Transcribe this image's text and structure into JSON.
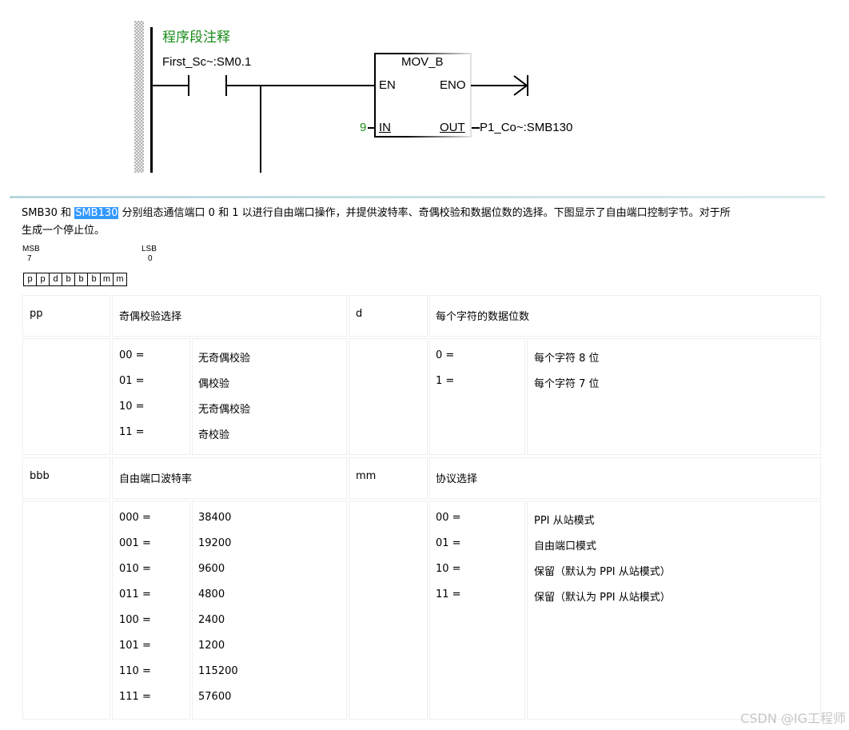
{
  "ladder": {
    "segment_comment": "程序段注释",
    "contact_label": "First_Sc~:SM0.1",
    "box_title": "MOV_B",
    "en": "EN",
    "eno": "ENO",
    "in_value": "9",
    "in_label": "IN",
    "out_label": "OUT",
    "out_address": "P1_Co~:SMB130"
  },
  "description": {
    "line1_pre": "SMB30 和 ",
    "line1_highlight": "SMB130",
    "line1_post": " 分别组态通信端口 0 和 1 以进行自由端口操作，并提供波特率、奇偶校验和数据位数的选择。下图显示了自由端口控制字节。对于所",
    "line2": "生成一个停止位。"
  },
  "bit_diagram": {
    "msb": "MSB",
    "msb_num": "7",
    "lsb": "LSB",
    "lsb_num": "0",
    "bits": [
      "p",
      "p",
      "d",
      "b",
      "b",
      "b",
      "m",
      "m"
    ]
  },
  "table1": {
    "h1": "pp",
    "h2": "奇偶校验选择",
    "h3": "d",
    "h4": "每个字符的数据位数",
    "parity": [
      {
        "code": "00 =",
        "desc": "无奇偶校验"
      },
      {
        "code": "01 =",
        "desc": "偶校验"
      },
      {
        "code": "10 =",
        "desc": "无奇偶校验"
      },
      {
        "code": "11 =",
        "desc": "奇校验"
      }
    ],
    "databits": [
      {
        "code": "0 =",
        "desc": "每个字符 8 位"
      },
      {
        "code": "1 =",
        "desc": "每个字符 7 位"
      }
    ]
  },
  "table2": {
    "h1": "bbb",
    "h2": "自由端口波特率",
    "h3": "mm",
    "h4": "协议选择",
    "baud": [
      {
        "code": "000 =",
        "desc": "38400"
      },
      {
        "code": "001 =",
        "desc": "19200"
      },
      {
        "code": "010 =",
        "desc": "9600"
      },
      {
        "code": "011 =",
        "desc": "4800"
      },
      {
        "code": "100 =",
        "desc": "2400"
      },
      {
        "code": "101 =",
        "desc": "1200"
      },
      {
        "code": "110 =",
        "desc": "115200"
      },
      {
        "code": "111 =",
        "desc": "57600"
      }
    ],
    "protocol": [
      {
        "code": "00 =",
        "desc": "PPI 从站模式"
      },
      {
        "code": "01 =",
        "desc": "自由端口模式"
      },
      {
        "code": "10 =",
        "desc": "保留（默认为 PPI 从站模式）"
      },
      {
        "code": "11 =",
        "desc": "保留（默认为 PPI 从站模式）"
      }
    ]
  },
  "watermark": "CSDN @IG工程师"
}
